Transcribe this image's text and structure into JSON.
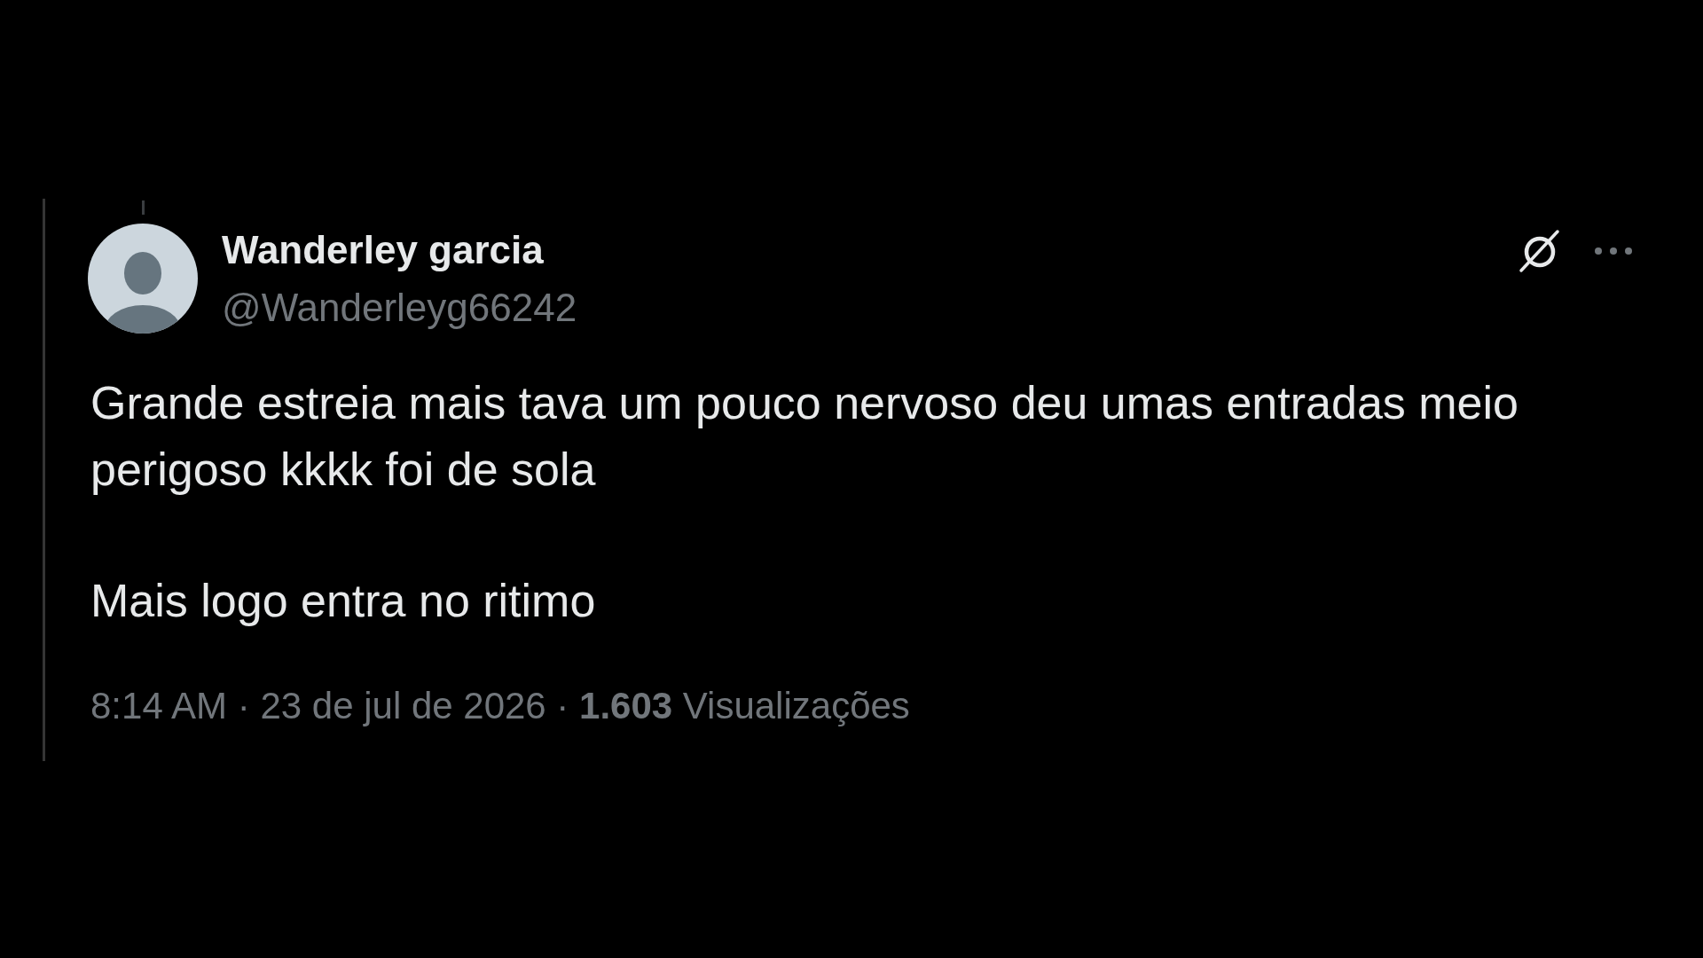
{
  "tweet": {
    "author": {
      "name": "Wanderley garcia",
      "handle": "@Wanderleyg66242"
    },
    "paragraphs": [
      "Grande estreia mais tava um pouco nervoso deu umas entradas meio perigoso kkkk foi de sola",
      "Mais logo entra no ritimo"
    ],
    "meta": "8:14 AM · 23 de jul de 2026 · **1.603** Visualizações"
  }
}
